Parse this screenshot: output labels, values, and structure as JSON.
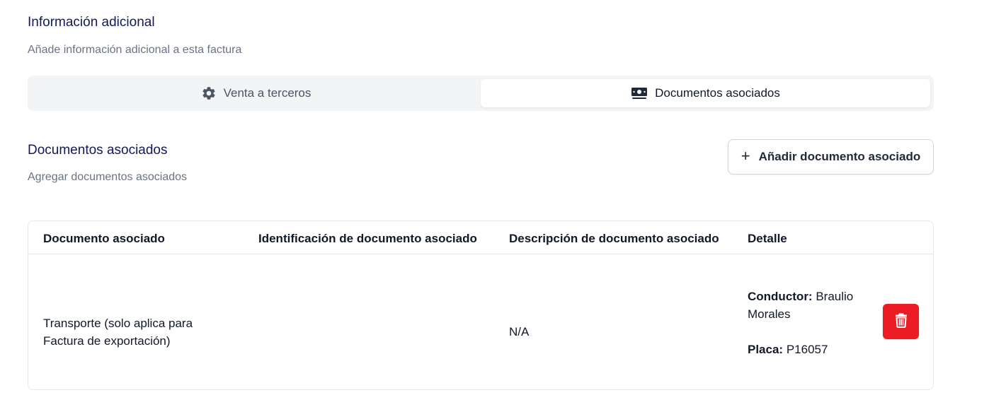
{
  "info_section": {
    "title": "Información adicional",
    "subtitle": "Añade información adicional a esta factura"
  },
  "tabs": [
    {
      "label": "Venta a terceros",
      "icon": "gear-icon",
      "active": false
    },
    {
      "label": "Documentos asociados",
      "icon": "money-bill-icon",
      "active": true
    }
  ],
  "docs_section": {
    "title": "Documentos asociados",
    "subtitle": "Agregar documentos asociados",
    "add_button_label": "Añadir documento asociado",
    "add_button_icon": "plus-icon"
  },
  "table": {
    "headers": [
      "Documento asociado",
      "Identificación de documento asociado",
      "Descripción de documento asociado",
      "Detalle"
    ],
    "rows": [
      {
        "documento_line1": "Transporte (solo aplica para",
        "documento_line2": "Factura de exportación)",
        "identificacion": "",
        "descripcion": "N/A",
        "detalle": {
          "conductor_label": "Conductor:",
          "conductor_value_line1": "Braulio",
          "conductor_value_line2": "Morales",
          "placa_label": "Placa:",
          "placa_value": "P16057"
        },
        "delete_icon": "trash-icon"
      }
    ]
  },
  "colors": {
    "heading": "#14185a",
    "muted": "#6b7280",
    "danger": "#ec1c24",
    "tab_bg": "#f3f4f6"
  }
}
